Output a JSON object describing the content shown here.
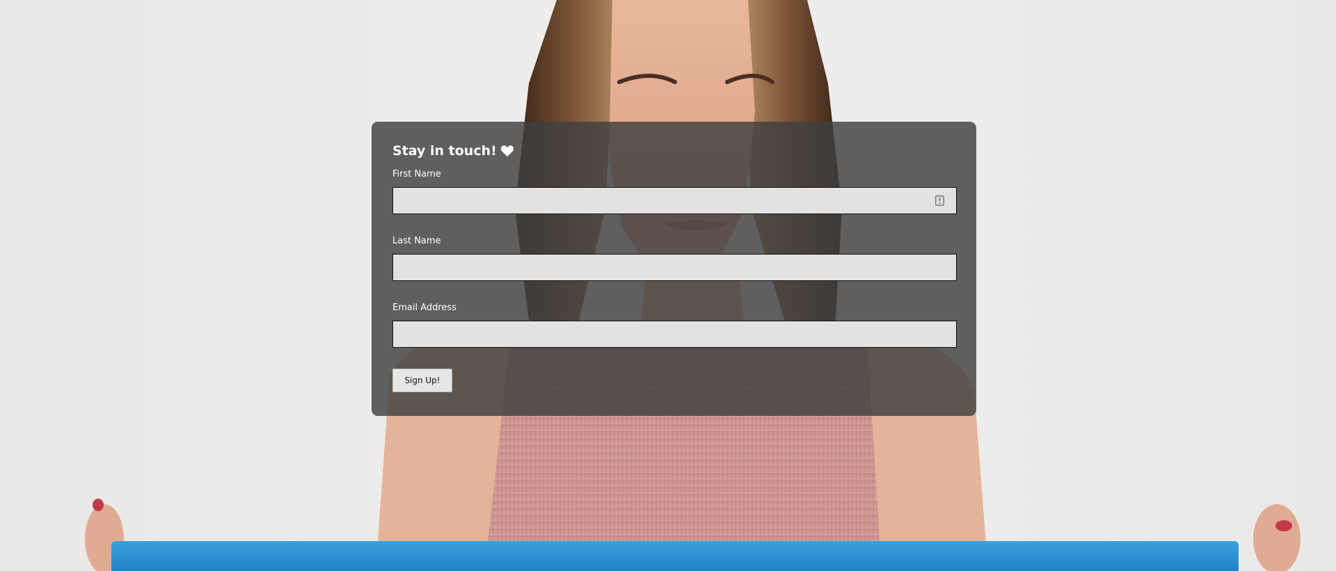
{
  "form": {
    "title": "Stay in touch!",
    "title_icon": "heart-icon",
    "fields": [
      {
        "label": "First Name",
        "value": "",
        "placeholder": "",
        "icon": "contact-card-icon"
      },
      {
        "label": "Last Name",
        "value": "",
        "placeholder": ""
      },
      {
        "label": "Email Address",
        "value": "",
        "placeholder": ""
      }
    ],
    "submit_label": "Sign Up!"
  },
  "colors": {
    "backdrop": "#ebebea",
    "card": "#404040",
    "input_bg": "#e2e2e2",
    "button_bg": "#e6e6e6",
    "mat": "#2b8fcf",
    "top": "#c98f8e"
  }
}
